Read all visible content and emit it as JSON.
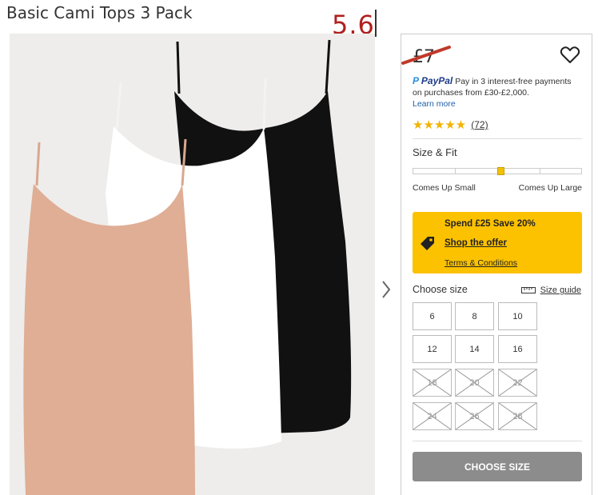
{
  "product": {
    "title": "Basic Cami Tops 3 Pack",
    "price_struck": "£7"
  },
  "annotation": {
    "new_price": "5.6"
  },
  "paypal": {
    "brand": "PayPal",
    "line1": "Pay in 3 interest-free payments",
    "line2": "on purchases from £30-£2,000.",
    "learn_more": "Learn more"
  },
  "rating": {
    "stars": "★★★★★",
    "value": 5,
    "review_count": "(72)"
  },
  "fit": {
    "title": "Size & Fit",
    "left_label": "Comes Up Small",
    "right_label": "Comes Up Large",
    "position": 0.52
  },
  "promo": {
    "title": "Spend £25 Save 20%",
    "link": "Shop the offer",
    "terms": "Terms & Conditions",
    "color": "#fcc200"
  },
  "sizes": {
    "heading": "Choose size",
    "guide_label": "Size guide",
    "options": [
      {
        "label": "6",
        "available": true
      },
      {
        "label": "8",
        "available": true
      },
      {
        "label": "10",
        "available": true
      },
      {
        "label": "12",
        "available": true
      },
      {
        "label": "14",
        "available": true
      },
      {
        "label": "16",
        "available": true
      },
      {
        "label": "18",
        "available": false
      },
      {
        "label": "20",
        "available": false
      },
      {
        "label": "22",
        "available": false
      },
      {
        "label": "24",
        "available": false
      },
      {
        "label": "26",
        "available": false
      },
      {
        "label": "28",
        "available": false
      }
    ]
  },
  "cta": {
    "label": "CHOOSE SIZE"
  },
  "icons": [
    "heart-icon",
    "paypal-icon",
    "chevron-right-icon",
    "price-tag-icon",
    "ruler-icon"
  ]
}
